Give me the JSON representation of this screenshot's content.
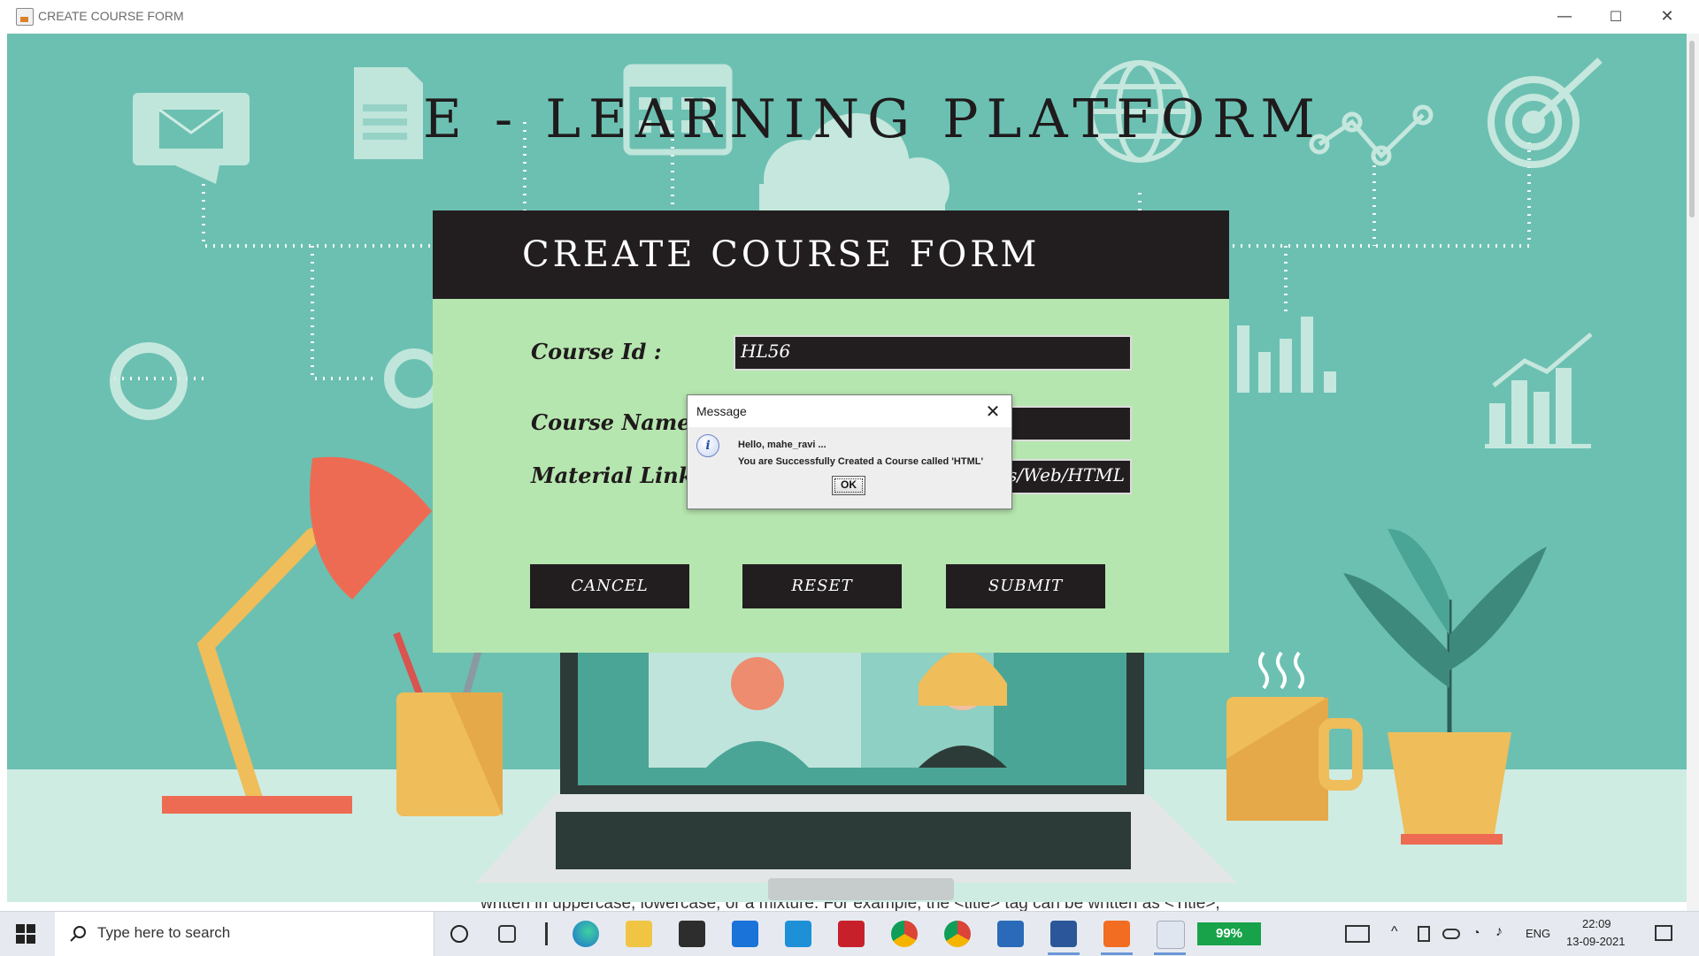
{
  "window": {
    "title": "CREATE COURSE FORM",
    "minimize": "—",
    "maximize": "☐",
    "close": "✕"
  },
  "app": {
    "main_title": "E - LEARNING PLATFORM"
  },
  "form": {
    "title": "CREATE COURSE FORM",
    "course_id_label": "Course Id :",
    "course_id_value": "HL56",
    "course_name_label": "Course Name",
    "course_name_value": "",
    "material_link_label": "Material Link",
    "material_link_value": "s/Web/HTML",
    "cancel_label": "CANCEL",
    "reset_label": "RESET",
    "submit_label": "SUBMIT"
  },
  "dialog": {
    "title": "Message",
    "close": "✕",
    "icon": "i",
    "line1": "Hello, mahe_ravi ...",
    "line2": "You are Successfully Created a Course called 'HTML'",
    "ok_label": "OK"
  },
  "background_text": "written in uppercase, lowercase, or a mixture. For example, the <title> tag can be written as <Title>,",
  "taskbar": {
    "search_placeholder": "Type here to search",
    "battery": "99%",
    "language": "ENG",
    "time": "22:09",
    "date": "13-09-2021",
    "icons": [
      "task-view-icon",
      "widgets-icon",
      "edge-icon",
      "file-explorer-icon",
      "store-icon",
      "mail-icon",
      "l-app-icon",
      "mcafee-icon",
      "chrome-icon",
      "chrome-profile-icon",
      "virtualbox-icon",
      "word-icon",
      "xampp-icon",
      "java-icon"
    ]
  },
  "colors": {
    "scene_bg": "#6cc0b1",
    "form_header": "#221e20",
    "form_body": "#b6e6af",
    "battery": "#18a34a"
  }
}
